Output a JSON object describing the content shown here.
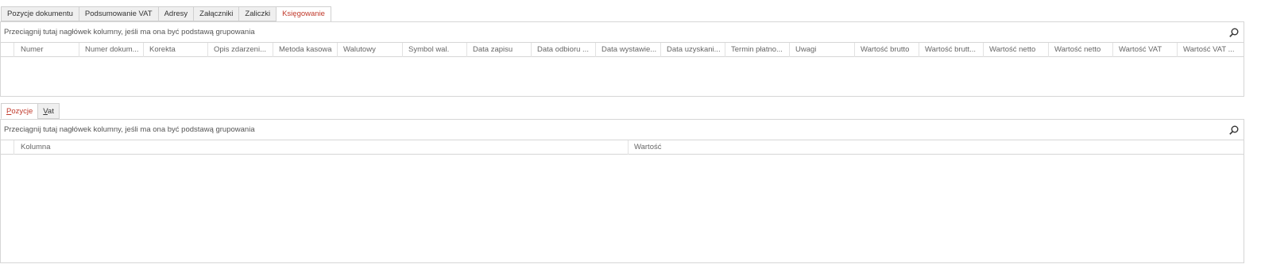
{
  "top_tabs": [
    {
      "label": "Pozycje dokumentu",
      "active": false
    },
    {
      "label": "Podsumowanie VAT",
      "active": false
    },
    {
      "label": "Adresy",
      "active": false
    },
    {
      "label": "Załączniki",
      "active": false
    },
    {
      "label": "Zaliczki",
      "active": false
    },
    {
      "label": "Księgowanie",
      "active": true
    }
  ],
  "top_grid": {
    "group_hint": "Przeciągnij tutaj nagłówek kolumny, jeśli ma ona być podstawą grupowania",
    "columns": [
      "Numer",
      "Numer dokum...",
      "Korekta",
      "Opis zdarzeni...",
      "Metoda kasowa",
      "Walutowy",
      "Symbol wal.",
      "Data zapisu",
      "Data odbioru ...",
      "Data wystawie...",
      "Data uzyskani...",
      "Termin płatno...",
      "Uwagi",
      "Wartość brutto",
      "Wartość brutt...",
      "Wartość netto",
      "Wartość netto",
      "Wartość VAT",
      "Wartość VAT ..."
    ],
    "rows": []
  },
  "sub_tabs": [
    {
      "first": "P",
      "rest": "ozycje",
      "active": true
    },
    {
      "first": "V",
      "rest": "at",
      "active": false
    }
  ],
  "bottom_grid": {
    "group_hint": "Przeciągnij tutaj nagłówek kolumny, jeśli ma ona być podstawą grupowania",
    "columns": [
      "Kolumna",
      "Wartość"
    ],
    "rows": []
  },
  "icons": {
    "search": "search-icon"
  },
  "colors": {
    "active_tab_text": "#c0392b",
    "border": "#d6d6d6",
    "tab_bg": "#efefef"
  }
}
